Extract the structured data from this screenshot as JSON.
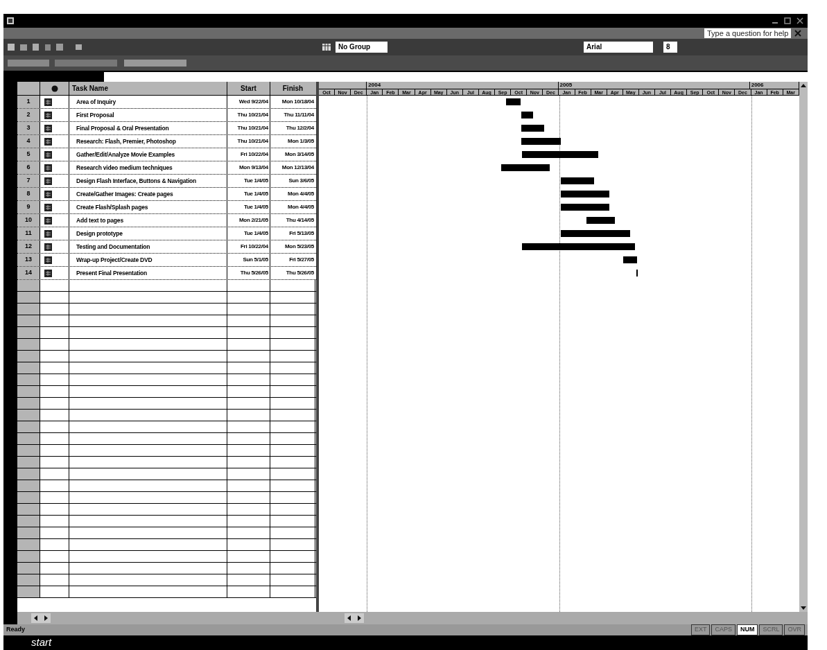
{
  "window": {
    "help_box": {
      "placeholder": "Type a question for help"
    }
  },
  "toolbar": {
    "group_field": "No Group",
    "font_field": "Arial",
    "size_field": "8"
  },
  "table": {
    "columns": [
      "Task Name",
      "Start",
      "Finish"
    ],
    "rows": [
      {
        "id": "1",
        "name": "Area of Inquiry",
        "start": "Wed 9/22/04",
        "finish": "Mon 10/18/04"
      },
      {
        "id": "2",
        "name": "First Proposal",
        "start": "Thu 10/21/04",
        "finish": "Thu 11/11/04"
      },
      {
        "id": "3",
        "name": "Final Proposal & Oral Presentation",
        "start": "Thu 10/21/04",
        "finish": "Thu 12/2/04"
      },
      {
        "id": "4",
        "name": "Research:  Flash, Premier, Photoshop",
        "start": "Thu 10/21/04",
        "finish": "Mon 1/3/05"
      },
      {
        "id": "5",
        "name": "Gather/Edit/Analyze Movie Examples",
        "start": "Fri 10/22/04",
        "finish": "Mon 3/14/05"
      },
      {
        "id": "6",
        "name": "Research video medium techniques",
        "start": "Mon 9/13/04",
        "finish": "Mon 12/13/04"
      },
      {
        "id": "7",
        "name": "Design Flash Interface, Buttons & Navigation",
        "start": "Tue 1/4/05",
        "finish": "Sun 3/6/05"
      },
      {
        "id": "8",
        "name": "Create/Gather Images:  Create pages",
        "start": "Tue 1/4/05",
        "finish": "Mon 4/4/05"
      },
      {
        "id": "9",
        "name": "Create Flash/Splash pages",
        "start": "Tue 1/4/05",
        "finish": "Mon 4/4/05"
      },
      {
        "id": "10",
        "name": "Add text to pages",
        "start": "Mon 2/21/05",
        "finish": "Thu 4/14/05"
      },
      {
        "id": "11",
        "name": "Design prototype",
        "start": "Tue 1/4/05",
        "finish": "Fri 5/13/05"
      },
      {
        "id": "12",
        "name": "Testing and Documentation",
        "start": "Fri 10/22/04",
        "finish": "Mon 5/23/05"
      },
      {
        "id": "13",
        "name": "Wrap-up Project/Create DVD",
        "start": "Sun 5/1/05",
        "finish": "Fri 5/27/05"
      },
      {
        "id": "14",
        "name": "Present Final Presentation",
        "start": "Thu 5/26/05",
        "finish": "Thu 5/26/05"
      }
    ]
  },
  "timescale": {
    "years": [
      {
        "label": "2004"
      },
      {
        "label": "2005"
      },
      {
        "label": "2006"
      }
    ],
    "months": [
      "Oct",
      "Nov",
      "Dec",
      "Jan",
      "Feb",
      "Mar",
      "Apr",
      "May",
      "Jun",
      "Jul",
      "Aug",
      "Sep",
      "Oct",
      "Nov",
      "Dec",
      "Jan",
      "Feb",
      "Mar",
      "Apr",
      "May",
      "Jun",
      "Jul",
      "Aug",
      "Sep",
      "Oct",
      "Nov",
      "Dec",
      "Jan",
      "Feb",
      "Mar"
    ]
  },
  "status_bar": {
    "text": "Ready",
    "indicators": [
      {
        "label": "EXT",
        "on": false
      },
      {
        "label": "CAPS",
        "on": false
      },
      {
        "label": "NUM",
        "on": true
      },
      {
        "label": "SCRL",
        "on": false
      },
      {
        "label": "OVR",
        "on": false
      }
    ]
  },
  "taskbar": {
    "start": "start"
  }
}
